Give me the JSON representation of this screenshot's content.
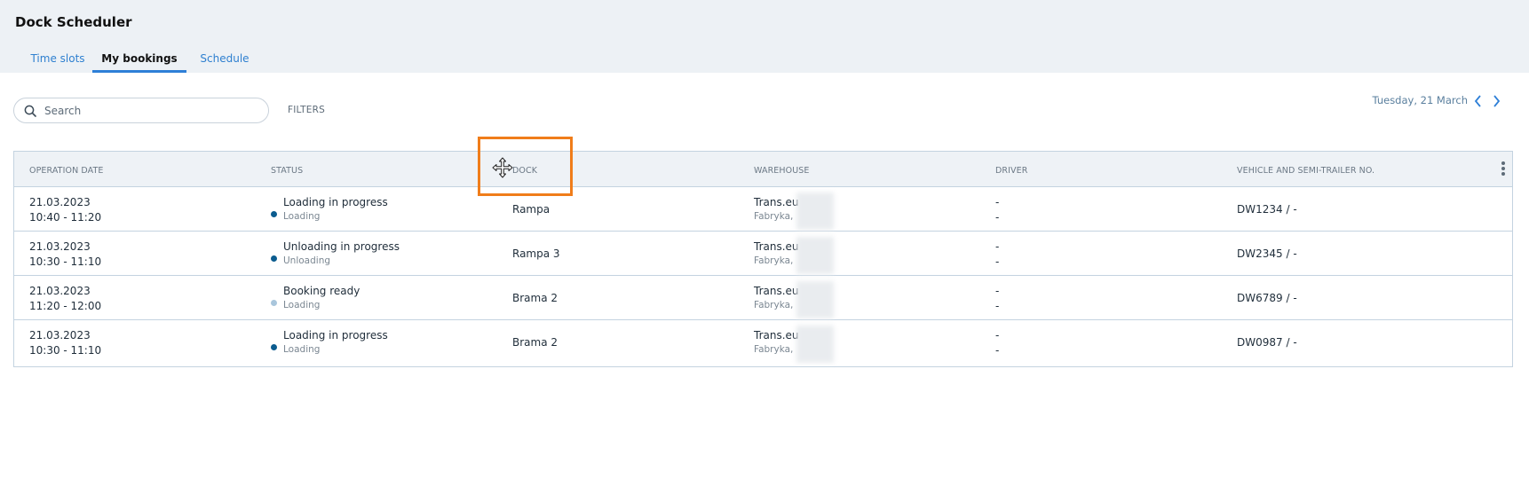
{
  "app": {
    "title": "Dock Scheduler"
  },
  "tabs": [
    {
      "label": "Time slots",
      "active": false
    },
    {
      "label": "My bookings",
      "active": true
    },
    {
      "label": "Schedule",
      "active": false
    }
  ],
  "toolbar": {
    "search_placeholder": "Search",
    "search_icon": "search-icon",
    "filters_label": "FILTERS",
    "date_label": "Tuesday, 21 March",
    "prev_icon": "chevron-left-icon",
    "next_icon": "chevron-right-icon"
  },
  "table": {
    "columns": [
      "OPERATION DATE",
      "STATUS",
      "DOCK",
      "WAREHOUSE",
      "DRIVER",
      "VEHICLE AND SEMI-TRAILER NO."
    ],
    "menu_icon": "kebab-menu-icon",
    "rows": [
      {
        "date": "21.03.2023",
        "time": "10:40 - 11:20",
        "status": "Loading in progress",
        "operation": "Loading",
        "status_color": "#0b5c8f",
        "dock": "Rampa",
        "warehouse_name": "Trans.eu",
        "warehouse_city": "Fabryka,",
        "driver_name": "-",
        "driver_phone": "-",
        "vehicle": "DW1234 / -"
      },
      {
        "date": "21.03.2023",
        "time": "10:30 - 11:10",
        "status": "Unloading in progress",
        "operation": "Unloading",
        "status_color": "#0b5c8f",
        "dock": "Rampa 3",
        "warehouse_name": "Trans.eu",
        "warehouse_city": "Fabryka,",
        "driver_name": "-",
        "driver_phone": "-",
        "vehicle": "DW2345 / -"
      },
      {
        "date": "21.03.2023",
        "time": "11:20 - 12:00",
        "status": "Booking ready",
        "operation": "Loading",
        "status_color": "#a9c6dc",
        "dock": "Brama 2",
        "warehouse_name": "Trans.eu",
        "warehouse_city": "Fabryka,",
        "driver_name": "-",
        "driver_phone": "-",
        "vehicle": "DW6789 / -"
      },
      {
        "date": "21.03.2023",
        "time": "10:30 - 11:10",
        "status": "Loading in progress",
        "operation": "Loading",
        "status_color": "#0b5c8f",
        "dock": "Brama 2",
        "warehouse_name": "Trans.eu",
        "warehouse_city": "Fabryka,",
        "driver_name": "-",
        "driver_phone": "-",
        "vehicle": "DW0987 / -"
      }
    ]
  },
  "colors": {
    "accent": "#2e7fd7",
    "highlight": "#f07d1a",
    "header_bg": "#edf1f5"
  }
}
